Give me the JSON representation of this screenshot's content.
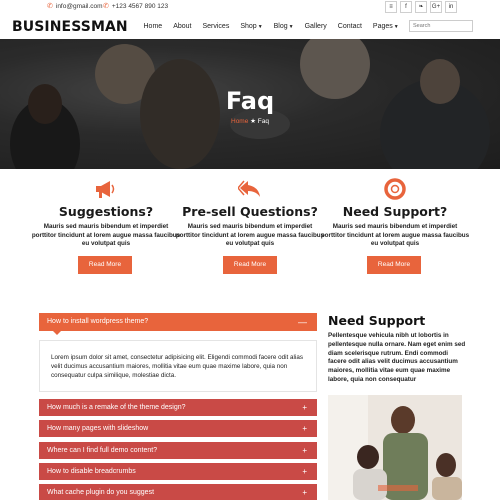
{
  "topbar": {
    "email": "info@gmail.com",
    "phone": "+123 4567 890 123",
    "social": [
      {
        "icon": "rss-icon",
        "glyph": "≡"
      },
      {
        "icon": "facebook-icon",
        "glyph": "f"
      },
      {
        "icon": "twitter-icon",
        "glyph": "❧"
      },
      {
        "icon": "google-plus-icon",
        "glyph": "G+"
      },
      {
        "icon": "linkedin-icon",
        "glyph": "in"
      }
    ]
  },
  "header": {
    "logo": "BUSINESSMAN",
    "nav": [
      "Home",
      "About",
      "Services",
      "Shop",
      "Blog",
      "Gallery",
      "Contact",
      "Pages"
    ],
    "search_placeholder": "Search"
  },
  "hero": {
    "title": "Faq",
    "breadcrumb_home": "Home",
    "breadcrumb_separator": "★",
    "breadcrumb_current": "Faq"
  },
  "features": [
    {
      "icon": "megaphone-icon",
      "title": "Suggestions?",
      "text": "Mauris sed mauris bibendum et imperdiet porttitor tincidunt at lorem augue massa faucibus eu volutpat quis",
      "button": "Read More"
    },
    {
      "icon": "reply-all-icon",
      "title": "Pre-sell Questions?",
      "text": "Mauris sed mauris bibendum et imperdiet porttitor tincidunt at lorem augue massa faucibus eu volutpat quis",
      "button": "Read More"
    },
    {
      "icon": "lifebuoy-icon",
      "title": "Need Support?",
      "text": "Mauris sed mauris bibendum et imperdiet porttitor tincidunt at lorem augue massa faucibus eu volutpat quis",
      "button": "Read More"
    }
  ],
  "faq": {
    "open_question": "How to install wordpress theme?",
    "open_answer": "Lorem ipsum dolor sit amet, consectetur adipisicing elit. Eligendi commodi facere odit alias velit ducimus accusantium maiores, mollitia vitae eum quae maxime labore, quia non consequatur culpa similique, molestiae dicta.",
    "questions": [
      "How much is a remake of the theme design?",
      "How many pages with slideshow",
      "Where can I find full demo content?",
      "How to disable breadcrumbs",
      "What cache plugin do you suggest"
    ]
  },
  "sidebar": {
    "title": "Need Support",
    "text": "Pellentesque vehicula nibh ut lobortis in pellentesque nulla ornare. Nam eget enim sed diam scelerisque rutrum. Endi commodi facere odit alias velit ducimus accusantium maiores, mollitia vitae eum quae maxime labore, quia non consequatur"
  },
  "colors": {
    "accent": "#e8643c",
    "faq_row": "#c94a46",
    "hero_overlay": "#252525"
  }
}
